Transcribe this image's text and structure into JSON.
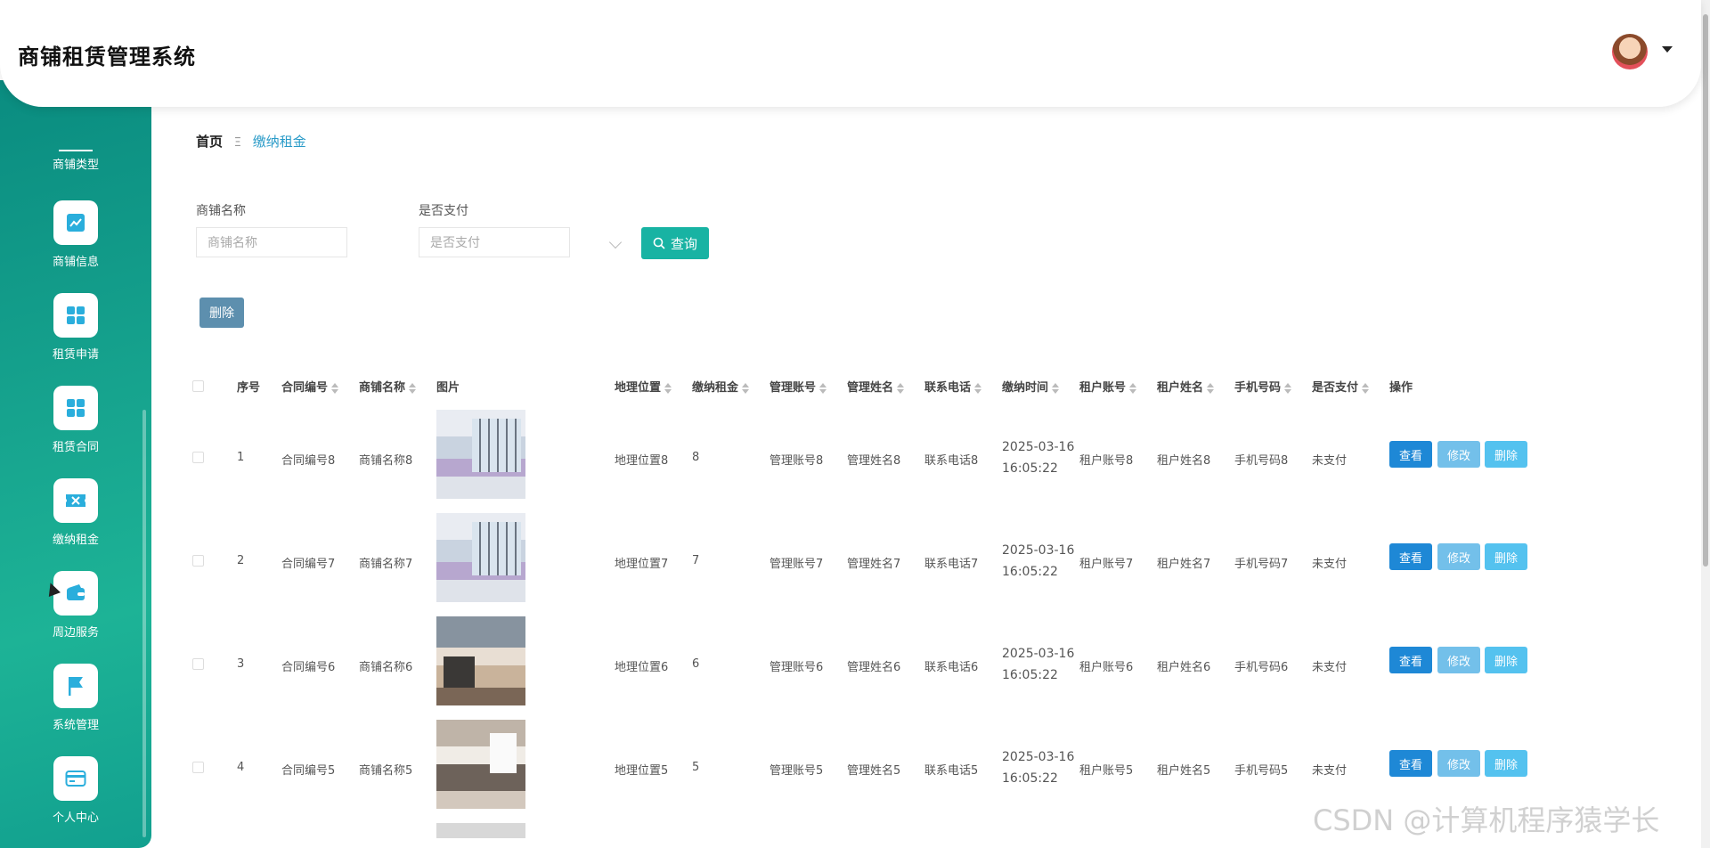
{
  "header": {
    "title": "商铺租赁管理系统"
  },
  "sidebar": {
    "items": [
      {
        "label": "商铺类型",
        "icon": "grid-icon"
      },
      {
        "label": "商铺信息",
        "icon": "chart-line-icon"
      },
      {
        "label": "租赁申请",
        "icon": "grid-icon"
      },
      {
        "label": "租赁合同",
        "icon": "grid-icon"
      },
      {
        "label": "缴纳租金",
        "icon": "ticket-icon"
      },
      {
        "label": "周边服务",
        "icon": "wallet-icon"
      },
      {
        "label": "系统管理",
        "icon": "flag-icon"
      },
      {
        "label": "个人中心",
        "icon": "card-icon"
      }
    ],
    "accent": "#17a58f"
  },
  "breadcrumb": {
    "home": "首页",
    "separator": "Ξ",
    "current": "缴纳租金"
  },
  "search": {
    "shop_name_label": "商铺名称",
    "shop_name_placeholder": "商铺名称",
    "paid_label": "是否支付",
    "paid_placeholder": "是否支付",
    "query_button": "查询"
  },
  "toolbar": {
    "delete_button": "删除"
  },
  "table": {
    "headers": [
      "序号",
      "合同编号",
      "商铺名称",
      "图片",
      "地理位置",
      "缴纳租金",
      "管理账号",
      "管理姓名",
      "联系电话",
      "缴纳时间",
      "租户账号",
      "租户姓名",
      "手机号码",
      "是否支付",
      "操作"
    ],
    "rows": [
      {
        "index": "1",
        "contract": "合同编号8",
        "shop": "商铺名称8",
        "location": "地理位置8",
        "rent": "8",
        "mgr_account": "管理账号8",
        "mgr_name": "管理姓名8",
        "phone": "联系电话8",
        "time": "2025-03-16 16:05:22",
        "tenant_account": "租户账号8",
        "tenant_name": "租户姓名8",
        "mobile": "手机号码8",
        "paid": "未支付"
      },
      {
        "index": "2",
        "contract": "合同编号7",
        "shop": "商铺名称7",
        "location": "地理位置7",
        "rent": "7",
        "mgr_account": "管理账号7",
        "mgr_name": "管理姓名7",
        "phone": "联系电话7",
        "time": "2025-03-16 16:05:22",
        "tenant_account": "租户账号7",
        "tenant_name": "租户姓名7",
        "mobile": "手机号码7",
        "paid": "未支付"
      },
      {
        "index": "3",
        "contract": "合同编号6",
        "shop": "商铺名称6",
        "location": "地理位置6",
        "rent": "6",
        "mgr_account": "管理账号6",
        "mgr_name": "管理姓名6",
        "phone": "联系电话6",
        "time": "2025-03-16 16:05:22",
        "tenant_account": "租户账号6",
        "tenant_name": "租户姓名6",
        "mobile": "手机号码6",
        "paid": "未支付"
      },
      {
        "index": "4",
        "contract": "合同编号5",
        "shop": "商铺名称5",
        "location": "地理位置5",
        "rent": "5",
        "mgr_account": "管理账号5",
        "mgr_name": "管理姓名5",
        "phone": "联系电话5",
        "time": "2025-03-16 16:05:22",
        "tenant_account": "租户账号5",
        "tenant_name": "租户姓名5",
        "mobile": "手机号码5",
        "paid": "未支付"
      }
    ],
    "actions": {
      "view": "查看",
      "edit": "修改",
      "delete": "删除"
    }
  },
  "watermark": "CSDN @计算机程序猿学长"
}
